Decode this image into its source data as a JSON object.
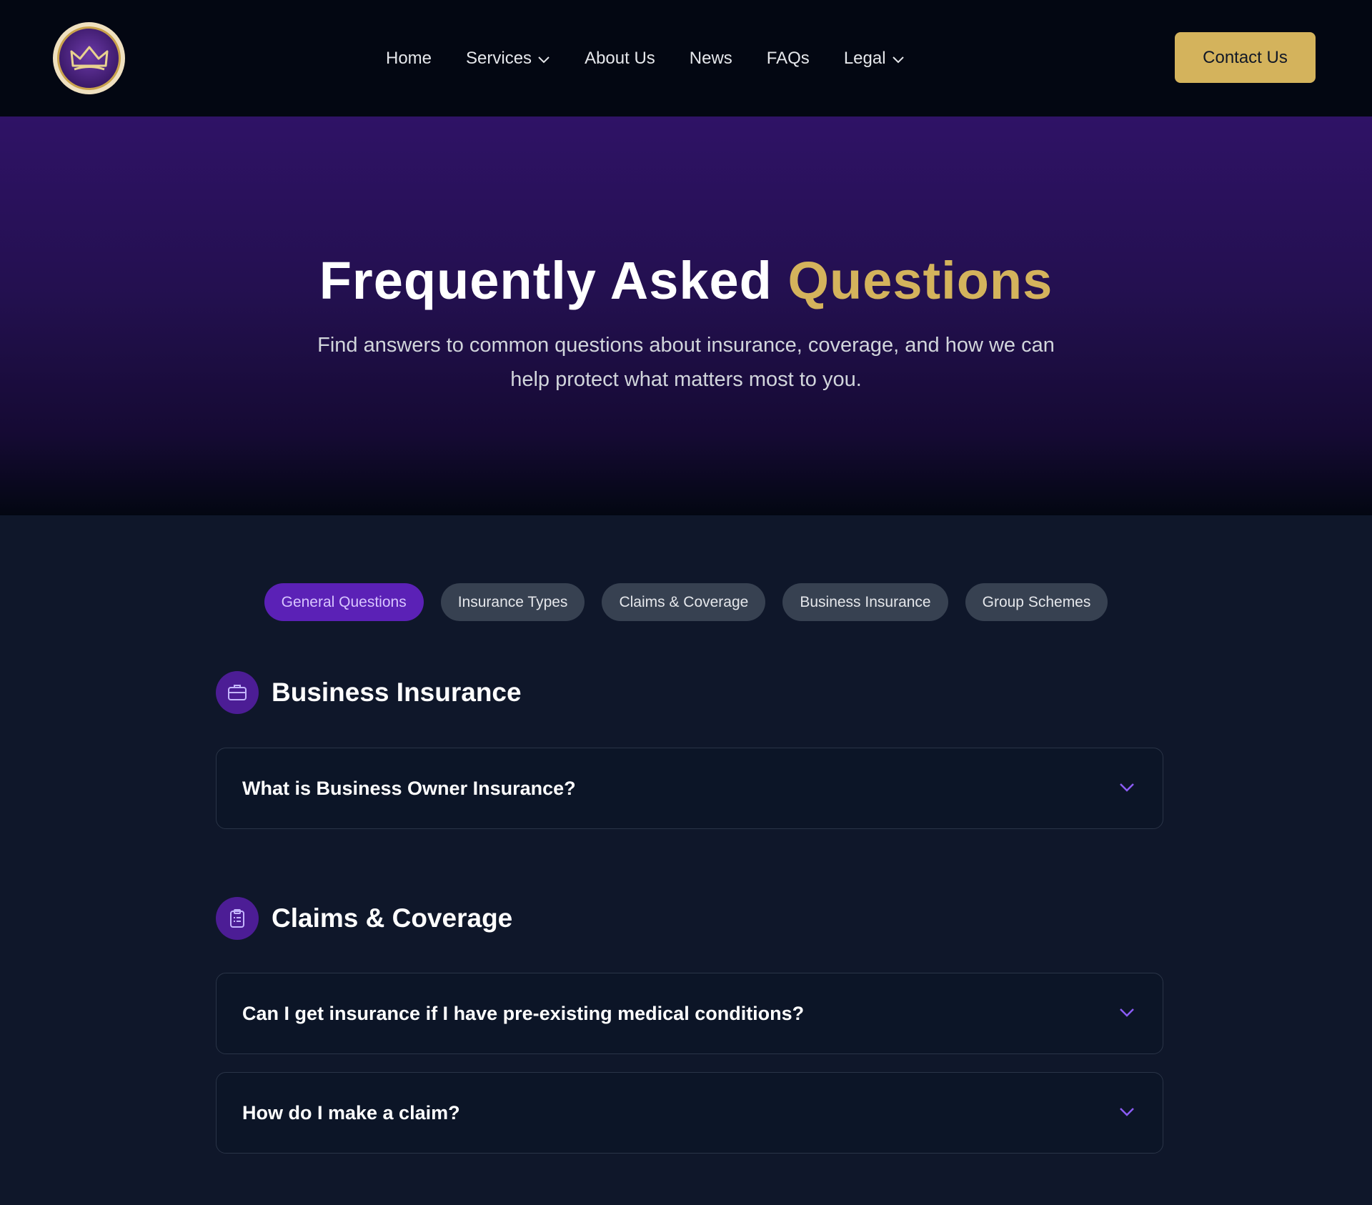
{
  "nav": {
    "links": [
      {
        "label": "Home",
        "dropdown": false
      },
      {
        "label": "Services",
        "dropdown": true
      },
      {
        "label": "About Us",
        "dropdown": false
      },
      {
        "label": "News",
        "dropdown": false
      },
      {
        "label": "FAQs",
        "dropdown": false
      },
      {
        "label": "Legal",
        "dropdown": true
      }
    ],
    "contact_label": "Contact Us"
  },
  "hero": {
    "title_main": "Frequently Asked ",
    "title_accent": "Questions",
    "subtitle": "Find answers to common questions about insurance, coverage, and how we can help protect what matters most to you."
  },
  "tabs": [
    {
      "label": "General Questions",
      "active": true
    },
    {
      "label": "Insurance Types",
      "active": false
    },
    {
      "label": "Claims & Coverage",
      "active": false
    },
    {
      "label": "Business Insurance",
      "active": false
    },
    {
      "label": "Group Schemes",
      "active": false
    }
  ],
  "sections": [
    {
      "title": "Business Insurance",
      "icon": "briefcase-icon",
      "questions": [
        "What is Business Owner Insurance?"
      ]
    },
    {
      "title": "Claims & Coverage",
      "icon": "clipboard-icon",
      "questions": [
        "Can I get insurance if I have pre-existing medical conditions?",
        "How do I make a claim?"
      ]
    }
  ],
  "colors": {
    "accent_gold": "#d4b35c",
    "accent_purple": "#5b21b6",
    "background": "#0f172a",
    "chevron": "#8b5cf6"
  }
}
